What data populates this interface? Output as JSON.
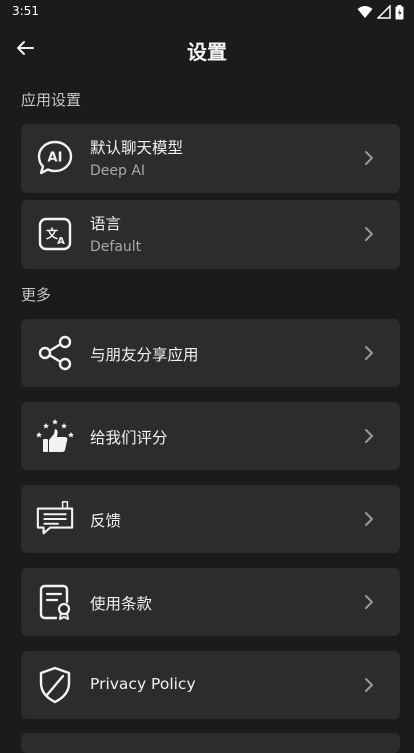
{
  "status": {
    "time": "3:51"
  },
  "header": {
    "title": "设置"
  },
  "sections": [
    {
      "label": "应用设置",
      "items": [
        {
          "title": "默认聊天模型",
          "subtitle": "Deep AI",
          "icon": "ai-chat-icon"
        },
        {
          "title": "语言",
          "subtitle": "Default",
          "icon": "translate-icon"
        }
      ]
    },
    {
      "label": "更多",
      "items": [
        {
          "title": "与朋友分享应用",
          "icon": "share-icon"
        },
        {
          "title": "给我们评分",
          "icon": "rate-thumbs-up-icon"
        },
        {
          "title": "反馈",
          "icon": "feedback-icon"
        },
        {
          "title": "使用条款",
          "icon": "terms-document-icon"
        },
        {
          "title": "Privacy Policy",
          "icon": "privacy-shield-icon"
        }
      ]
    }
  ],
  "colors": {
    "background": "#1b1b1b",
    "card": "#2c2c2c",
    "text": "#f2f2f2",
    "subtext": "#a8a8a8"
  }
}
